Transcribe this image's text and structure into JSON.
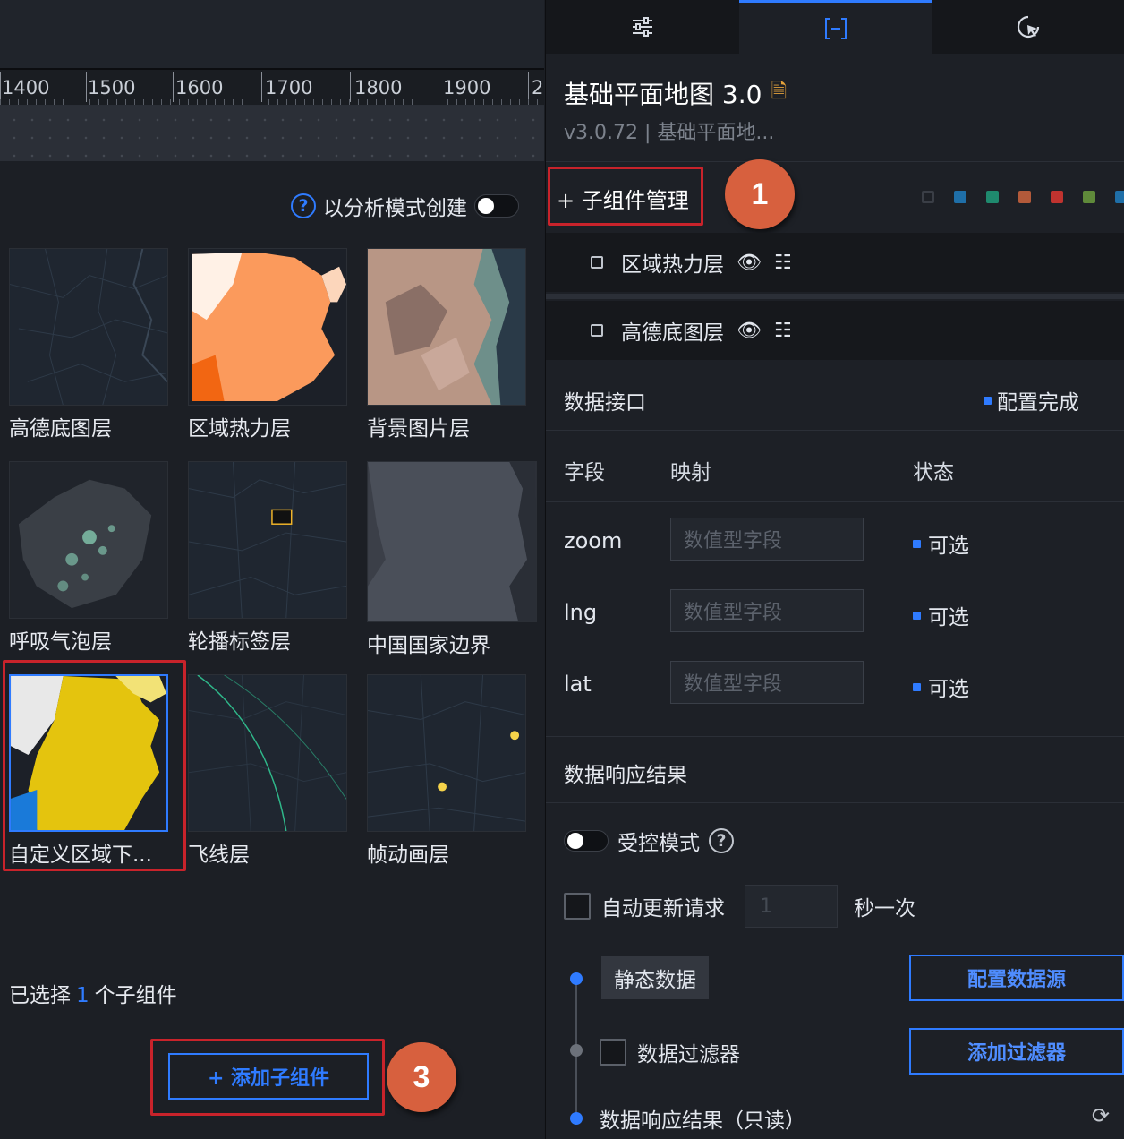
{
  "ruler": {
    "ticks": [
      "1400",
      "1500",
      "1600",
      "1700",
      "1800",
      "1900",
      "2"
    ]
  },
  "left_panel": {
    "analysis_mode_label": "以分析模式创建",
    "help_icon": "question-circle-icon",
    "tiles": [
      {
        "label": "高德底图层"
      },
      {
        "label": "区域热力层"
      },
      {
        "label": "背景图片层"
      },
      {
        "label": "呼吸气泡层"
      },
      {
        "label": "轮播标签层"
      },
      {
        "label": "中国国家边界"
      },
      {
        "label": "自定义区域下..."
      },
      {
        "label": "飞线层"
      },
      {
        "label": "帧动画层"
      }
    ],
    "selected_prefix": "已选择",
    "selected_count": "1",
    "selected_suffix": "个子组件",
    "add_button_label": "+ 添加子组件",
    "step_3": "3"
  },
  "right_panel": {
    "tabs": [
      {
        "icon": "sliders-icon"
      },
      {
        "icon": "bracket-frame-icon",
        "active": true
      },
      {
        "icon": "interaction-icon"
      }
    ],
    "title": "基础平面地图 3.0",
    "version": "v3.0.72 | 基础平面地...",
    "subcomp_header": "+ 子组件管理",
    "step_1": "1",
    "color_dots": [
      "#3a3e46",
      "#1f6fa8",
      "#1f8a6e",
      "#b35a3a",
      "#c0332f",
      "#5f8a3a",
      "#1f6fa8"
    ],
    "layers": [
      {
        "label": "区域热力层"
      },
      {
        "label": "高德底图层"
      }
    ],
    "data_interface_title": "数据接口",
    "config_status": "配置完成",
    "table_headers": {
      "field": "字段",
      "mapping": "映射",
      "status": "状态"
    },
    "fields": [
      {
        "name": "zoom",
        "placeholder": "数值型字段",
        "status": "可选"
      },
      {
        "name": "lng",
        "placeholder": "数值型字段",
        "status": "可选"
      },
      {
        "name": "lat",
        "placeholder": "数值型字段",
        "status": "可选"
      }
    ],
    "response_title": "数据响应结果",
    "controlled_mode": "受控模式",
    "auto_update": "自动更新请求",
    "auto_interval": "1",
    "auto_suffix": "秒一次",
    "static_data": "静态数据",
    "config_source_btn": "配置数据源",
    "data_filter": "数据过滤器",
    "add_filter_btn": "添加过滤器",
    "readonly_result": "数据响应结果（只读）"
  }
}
